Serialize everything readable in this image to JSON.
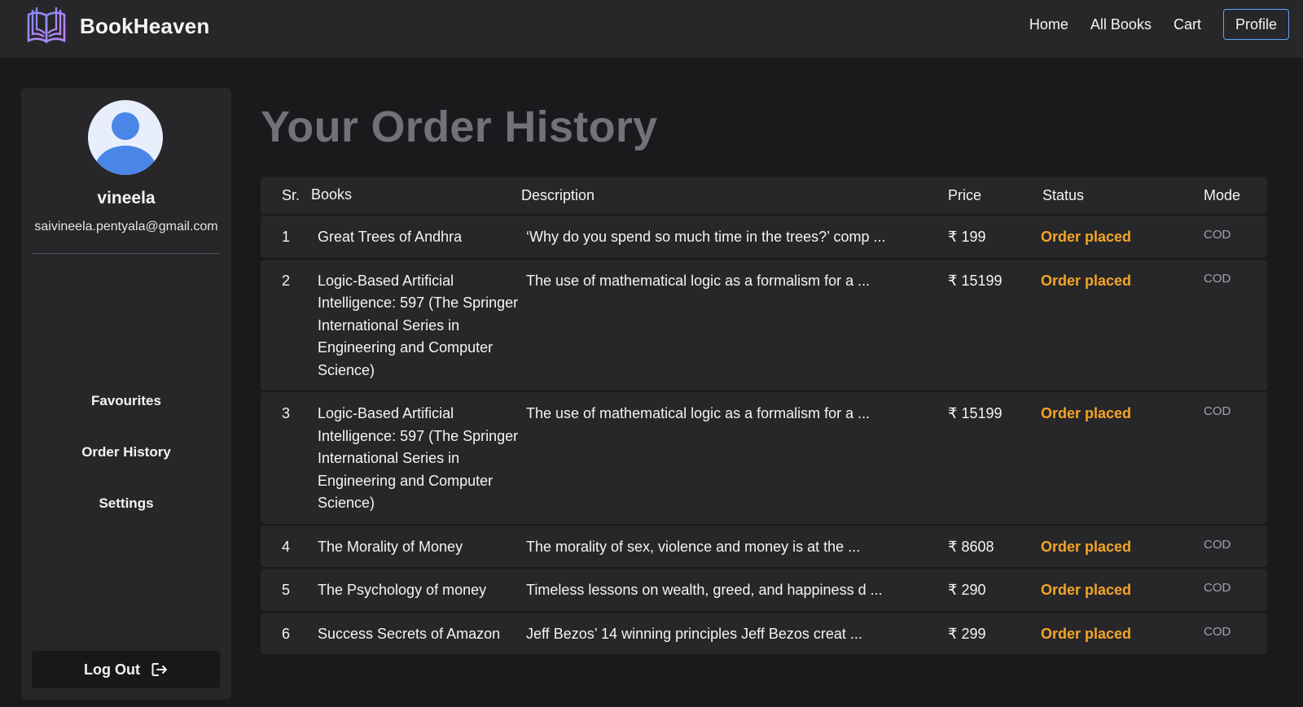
{
  "navbar": {
    "brand": "BookHeaven",
    "links": [
      "Home",
      "All Books",
      "Cart"
    ],
    "profile_label": "Profile"
  },
  "sidebar": {
    "user_name": "vineela",
    "user_email": "saivineela.pentyala@gmail.com",
    "items": [
      "Favourites",
      "Order History",
      "Settings"
    ],
    "logout_label": "Log Out"
  },
  "main": {
    "title": "Your Order History",
    "headers": {
      "sr": "Sr.",
      "books": "Books",
      "description": "Description",
      "price": "Price",
      "status": "Status",
      "mode": "Mode"
    },
    "orders": [
      {
        "sr": "1",
        "book": "Great Trees of Andhra",
        "description": "‘Why do you spend so much time in the trees?’ comp ...",
        "price": "₹ 199",
        "status": "Order placed",
        "mode": "COD"
      },
      {
        "sr": "2",
        "book": "Logic-Based Artificial Intelligence: 597 (The Springer International Series in Engineering and Computer Science)",
        "description": "The use of mathematical logic as a formalism for a ...",
        "price": "₹ 15199",
        "status": "Order placed",
        "mode": "COD"
      },
      {
        "sr": "3",
        "book": "Logic-Based Artificial Intelligence: 597 (The Springer International Series in Engineering and Computer Science)",
        "description": "The use of mathematical logic as a formalism for a ...",
        "price": "₹ 15199",
        "status": "Order placed",
        "mode": "COD"
      },
      {
        "sr": "4",
        "book": "The Morality of Money",
        "description": "The morality of sex, violence and money is at the ...",
        "price": "₹ 8608",
        "status": "Order placed",
        "mode": "COD"
      },
      {
        "sr": "5",
        "book": "The Psychology of money",
        "description": "Timeless lessons on wealth, greed, and happiness d ...",
        "price": "₹ 290",
        "status": "Order placed",
        "mode": "COD"
      },
      {
        "sr": "6",
        "book": "Success Secrets of Amazon",
        "description": "Jeff Bezos’ 14 winning principles Jeff Bezos creat ...",
        "price": "₹ 299",
        "status": "Order placed",
        "mode": "COD"
      }
    ]
  },
  "colors": {
    "page_bg": "#1a1a1d",
    "panel_bg": "#27272a",
    "status_accent": "#f5a524",
    "profile_border": "#60a5fa",
    "title_gray": "#71717a"
  },
  "icons": {
    "brand": "open-book-icon",
    "avatar": "user-avatar-icon",
    "logout": "logout-arrow-icon"
  }
}
